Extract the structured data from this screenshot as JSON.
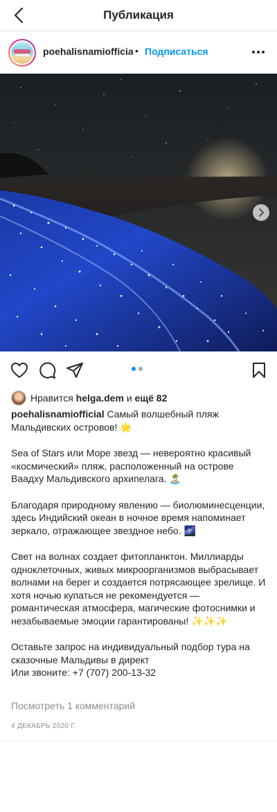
{
  "topbar": {
    "title": "Публикация",
    "back_icon": "chevron-left-icon"
  },
  "post_header": {
    "username": "poehalisnamiofficial",
    "separator": "•",
    "follow_label": "Подписаться",
    "more_icon": "more-horizontal-icon"
  },
  "carousel": {
    "current": 1,
    "total": 2,
    "next_icon": "chevron-right-icon"
  },
  "actions": {
    "icons": [
      "heart-icon",
      "comment-icon",
      "share-icon",
      "bookmark-icon"
    ]
  },
  "likes": {
    "prefix": "Нравится",
    "user": "helga.dem",
    "connector": "и",
    "others": "ещё 82"
  },
  "caption": {
    "username": "poehalisnamiofficial",
    "p1": "Самый волшебный пляж Мальдивских островов! 🌟",
    "p2": "Sea of Stars или Море звезд — невероятно красивый «космический» пляж, расположенный на острове Ваадху Мальдивского архипелага. 🏝️",
    "p3": "Благодаря природному явлению — биолюминесценции, здесь Индийский океан в ночное время напоминает зеркало, отражающее звездное небо. 🌌",
    "p4": "Свет на волнах создает фитопланктон. Миллиарды одноклеточных, живых микроорганизмов выбрасывает волнами на берег и создается потрясающее зрелище. И хотя ночью купаться не рекомендуется — романтическая атмосфера, магические фотоснимки и незабываемые эмоции гарантированы! ✨✨✨",
    "p5_line1": "Оставьте запрос на индивидуальный подбор тура на сказочные Мальдивы в директ",
    "p5_line2": "Или звоните: +7 (707) 200-13-32"
  },
  "comments_link": "Посмотреть 1 комментарий",
  "date": "4 ДЕКАБРЬ 2020 Г.",
  "colors": {
    "accent": "#0095f6",
    "text": "#262626",
    "muted": "#8e8e8e",
    "carousel_active": "#0095f6",
    "carousel_inactive": "#a8a8a8"
  }
}
